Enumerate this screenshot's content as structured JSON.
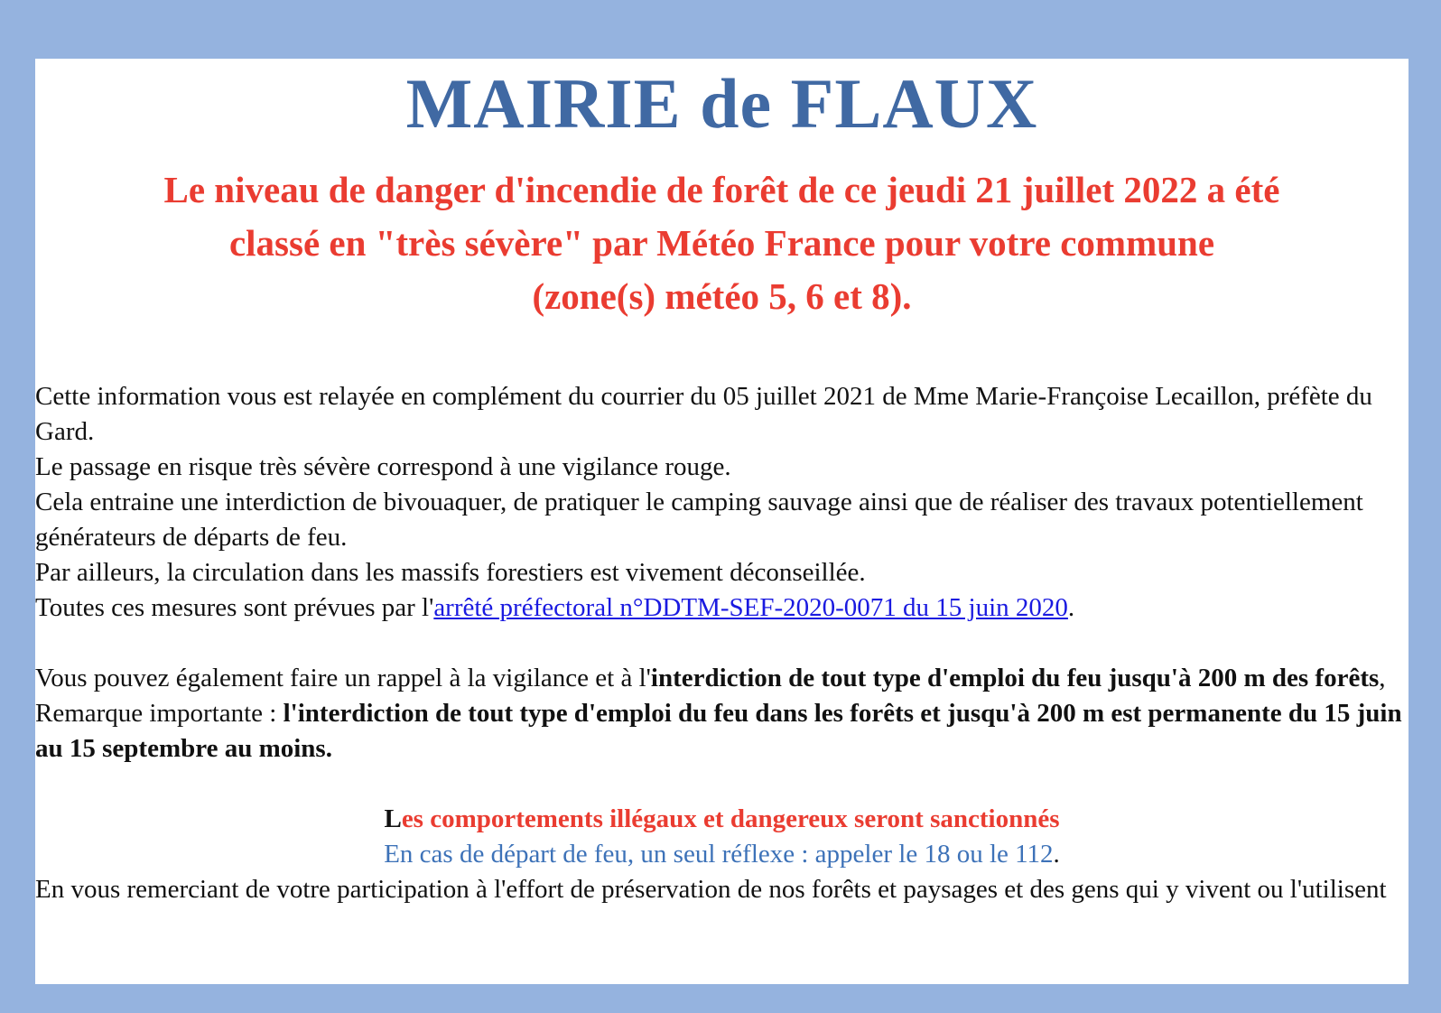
{
  "header": {
    "title": "MAIRIE de FLAUX"
  },
  "alert": {
    "line1": "Le niveau de danger d'incendie de forêt de ce jeudi 21 juillet 2022 a été",
    "line2": "classé en \"très sévère\" par Météo France pour votre commune",
    "line3": "(zone(s) météo 5, 6 et 8)."
  },
  "body": {
    "p1": "Cette information vous est relayée en complément du courrier du 05 juillet 2021 de Mme Marie-Françoise Lecaillon, préfète du Gard.",
    "p2": "Le passage en risque très sévère correspond à une vigilance rouge.",
    "p3": "Cela entraine une interdiction de bivouaquer, de pratiquer le camping sauvage ainsi que de réaliser des travaux potentiellement générateurs de départs de feu.",
    "p4": "Par ailleurs, la circulation dans les massifs forestiers est vivement déconseillée.",
    "p5_prefix": "Toutes ces mesures sont prévues par l'",
    "p5_link": "arrêté préfectoral n°DDTM-SEF-2020-0071 du 15 juin 2020",
    "p5_suffix": ".",
    "p6_prefix": "Vous pouvez également faire un rappel à la vigilance et à l'",
    "p6_bold": "interdiction de tout type d'emploi du feu jusqu'à 200 m des forêts",
    "p6_suffix": ",",
    "p7_prefix": "Remarque importante :  ",
    "p7_bold": "l'interdiction de tout type d'emploi du feu dans les forêts et jusqu'à 200 m est permanente du 15 juin au 15 septembre au moins.",
    "warning_first": "L",
    "warning_rest": "es comportements illégaux et dangereux seront sanctionnés",
    "reflex": "En cas de départ de feu, un seul réflexe : appeler le 18 ou le 112",
    "reflex_suffix": ".",
    "closing": "En vous remerciant de votre participation à l'effort de préservation de nos forêts et paysages et des gens qui y vivent ou l'utilisent"
  },
  "colors": {
    "background": "#95b3df",
    "title": "#4069a3",
    "alert": "#ea3c31",
    "link": "#1a1ae0",
    "reflex": "#3d72b8"
  }
}
